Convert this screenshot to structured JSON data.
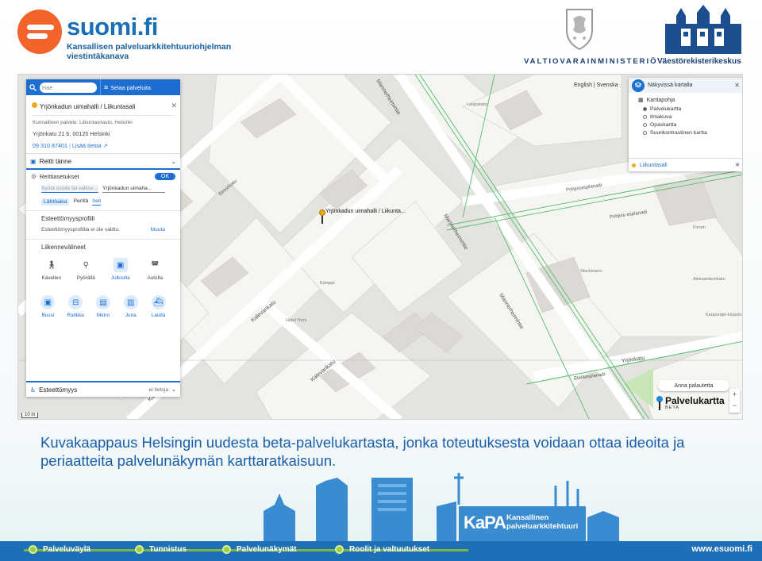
{
  "header": {
    "suomi_logo_word": "suomi.fi",
    "suomi_logo_sub": "Kansallisen palveluarkkitehtuuriohjelman viestintäkanava",
    "vm_logo_text": "VALTIOVARAINMINISTERIÖ",
    "vrk_logo_text": "Väestörekisterikeskus"
  },
  "screenshot": {
    "search": {
      "placeholder": "Hae"
    },
    "browse_label": "Selaa palveluita",
    "poi": {
      "title": "Yrjönkadun uimahalli / Liikuntasali",
      "service_line": "Kunnallinen palvelu: Liikuntavirasto, Helsinki",
      "address": "Yrjönkatu 21 b, 00120 Helsinki",
      "phone": "09 310 87401",
      "more_info": "Lisää tietoa"
    },
    "route": {
      "title": "Reitti tänne",
      "settings_label": "Reittiasetukset",
      "ok_label": "OK",
      "from_placeholder": "Syötä osoite tai valitse...",
      "to_value": "Yrjönkadun uimaha...",
      "time_options": [
        "Lähtöaika",
        "Perillä",
        "heti"
      ],
      "profile_heading": "Esteettömyysprofiili",
      "profile_text": "Esteettömyysprofiilia ei ole valittu.",
      "profile_change": "Muuta",
      "transport_heading": "Liikennevälineet",
      "modes": [
        "Kävellen",
        "Pyörällä",
        "Julkisilla",
        "Autolla"
      ],
      "transit_modes": [
        "Bussi",
        "Ratikka",
        "Metro",
        "Juna",
        "Lautta"
      ],
      "selected_mode": "Julkisilla"
    },
    "accessibility": {
      "label": "Esteettömyys",
      "value": "ei tietoja"
    },
    "languages": "English | Svenska",
    "layers": {
      "header": "Näkyvissä kartalla",
      "basemap_heading": "Karttapohja",
      "options": [
        "Palvelukartta",
        "Ilmakuva",
        "Opaskartta",
        "Suurikontrastinen kartta"
      ],
      "selected": "Palvelukartta",
      "active_layer": "Liikuntasali"
    },
    "map_marker_label": "Yrjönkadun uimahalli / Liikunta...",
    "street_labels": [
      "Mannerheimintie",
      "Mannerheimintie",
      "Mannerheimintie",
      "Kalevankatu",
      "Kalevankatu",
      "Kalevankatu",
      "Yrjönkatu",
      "Pohjoisesplanadi",
      "Eteläesplanadi",
      "Simonkatu",
      "Pohjois-esplanadi"
    ],
    "place_labels": [
      "Hotel Torni",
      "Stockmann",
      "Lasipalatsi",
      "Kamppi",
      "Forum",
      "Aleksanterinkatu",
      "Kaupungin-kirjasto"
    ],
    "feedback_label": "Anna palautetta",
    "zoom": [
      "+",
      "−"
    ],
    "brand": {
      "name": "Palvelukartta",
      "beta": "BETA"
    },
    "scale_label": "10 m"
  },
  "caption": "Kuvakaappaus Helsingin uudesta beta-palvelukartasta, jonka toteutuksesta voidaan ottaa ideoita ja periaatteita palvelunäkymän karttaratkaisuun.",
  "kapa": {
    "short": "KaPA",
    "text": "Kansallinen palveluarkkitehtuuri"
  },
  "footer": {
    "items": [
      "Palveluväylä",
      "Tunnistus",
      "Palvelunäkymät",
      "Roolit ja valtuutukset"
    ],
    "url": "www.esuomi.fi"
  },
  "colors": {
    "accent": "#1c6fd0",
    "caption": "#1a5ea8",
    "footer": "#1e6fb7",
    "suomi_orange": "#f2642a",
    "marker": "#f1a913"
  }
}
